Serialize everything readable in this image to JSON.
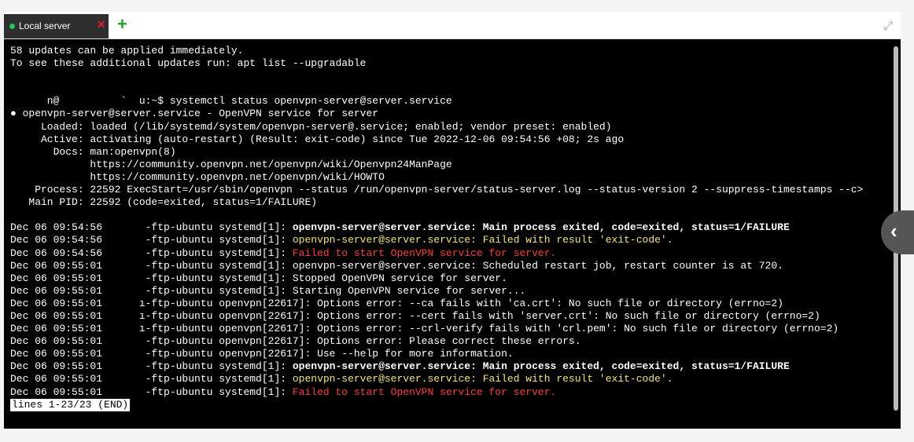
{
  "tabs": [
    {
      "label": "Local server",
      "close_icon": "×"
    }
  ],
  "add_tab_label": "+",
  "expand_icon": "⤢",
  "collapse_icon": "‹",
  "terminal_lines": [
    {
      "text": "58 updates can be applied immediately.",
      "style": ""
    },
    {
      "text": "To see these additional updates run: apt list --upgradable",
      "style": ""
    },
    {
      "text": "",
      "style": ""
    },
    {
      "text": "",
      "style": ""
    },
    {
      "text": "      n@          `  u:~$ systemctl status openvpn-server@server.service",
      "style": ""
    },
    {
      "text": "● openvpn-server@server.service - OpenVPN service for server",
      "style": ""
    },
    {
      "text": "     Loaded: loaded (/lib/systemd/system/openvpn-server@.service; enabled; vendor preset: enabled)",
      "style": ""
    },
    {
      "text": "     Active: activating (auto-restart) (Result: exit-code) since Tue 2022-12-06 09:54:56 +08; 2s ago",
      "style": ""
    },
    {
      "text": "       Docs: man:openvpn(8)",
      "style": ""
    },
    {
      "text": "             https://community.openvpn.net/openvpn/wiki/Openvpn24ManPage",
      "style": ""
    },
    {
      "text": "             https://community.openvpn.net/openvpn/wiki/HOWTO",
      "style": ""
    },
    {
      "text": "    Process: 22592 ExecStart=/usr/sbin/openvpn --status /run/openvpn-server/status-server.log --status-version 2 --suppress-timestamps --c>",
      "style": ""
    },
    {
      "text": "   Main PID: 22592 (code=exited, status=1/FAILURE)",
      "style": ""
    },
    {
      "text": "",
      "style": ""
    },
    {
      "text": "Dec 06 09:54:56       -ftp-ubuntu systemd[1]: ",
      "tail": "openvpn-server@server.service: Main process exited, code=exited, status=1/FAILURE",
      "style": "bold"
    },
    {
      "text": "Dec 06 09:54:56       -ftp-ubuntu systemd[1]: ",
      "tail": "openvpn-server@server.service: Failed with result 'exit-code'.",
      "style": "yellow"
    },
    {
      "text": "Dec 06 09:54:56       -ftp-ubuntu systemd[1]: ",
      "tail": "Failed to start OpenVPN service for server.",
      "style": "red"
    },
    {
      "text": "Dec 06 09:55:01       -ftp-ubuntu systemd[1]: openvpn-server@server.service: Scheduled restart job, restart counter is at 720.",
      "style": ""
    },
    {
      "text": "Dec 06 09:55:01       -ftp-ubuntu systemd[1]: Stopped OpenVPN service for server.",
      "style": ""
    },
    {
      "text": "Dec 06 09:55:01       -ftp-ubuntu systemd[1]: Starting OpenVPN service for server...",
      "style": ""
    },
    {
      "text": "Dec 06 09:55:01      ı-ftp-ubuntu openvpn[22617]: Options error: --ca fails with 'ca.crt': No such file or directory (errno=2)",
      "style": ""
    },
    {
      "text": "Dec 06 09:55:01      ı-ftp-ubuntu openvpn[22617]: Options error: --cert fails with 'server.crt': No such file or directory (errno=2)",
      "style": ""
    },
    {
      "text": "Dec 06 09:55:01      ı-ftp-ubuntu openvpn[22617]: Options error: --crl-verify fails with 'crl.pem': No such file or directory (errno=2)",
      "style": ""
    },
    {
      "text": "Dec 06 09:55:01       -ftp-ubuntu openvpn[22617]: Options error: Please correct these errors.",
      "style": ""
    },
    {
      "text": "Dec 06 09:55:01       -ftp-ubuntu openvpn[22617]: Use --help for more information.",
      "style": ""
    },
    {
      "text": "Dec 06 09:55:01       -ftp-ubuntu systemd[1]: ",
      "tail": "openvpn-server@server.service: Main process exited, code=exited, status=1/FAILURE",
      "style": "bold"
    },
    {
      "text": "Dec 06 09:55:01       -ftp-ubuntu systemd[1]: ",
      "tail": "openvpn-server@server.service: Failed with result 'exit-code'.",
      "style": "yellow"
    },
    {
      "text": "Dec 06 09:55:01       -ftp-ubuntu systemd[1]: ",
      "tail": "Failed to start OpenVPN service for server.",
      "style": "red"
    }
  ],
  "pager_status": "lines 1-23/23 (END)"
}
